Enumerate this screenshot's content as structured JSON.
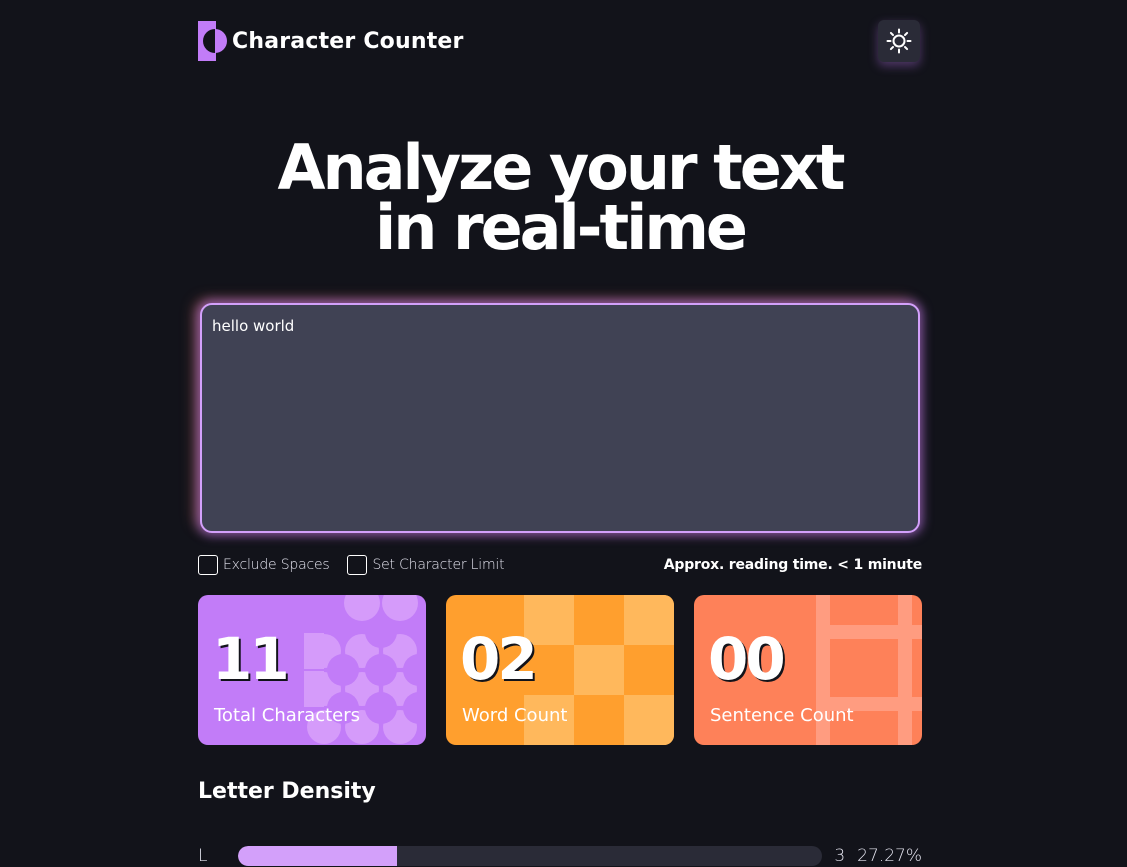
{
  "header": {
    "logo_text": "Character Counter",
    "theme_toggle_icon": "sun-icon"
  },
  "hero": {
    "line1": "Analyze your text",
    "line2": "in real-time"
  },
  "editor": {
    "value": "hello world"
  },
  "options": {
    "exclude_spaces_label": "Exclude Spaces",
    "exclude_spaces_checked": false,
    "char_limit_label": "Set Character Limit",
    "char_limit_checked": false,
    "reading_time": "Approx. reading time. < 1 minute"
  },
  "stats": {
    "total_characters": {
      "value": "11",
      "label": "Total Characters",
      "color": "#C27CF8"
    },
    "word_count": {
      "value": "02",
      "label": "Word Count",
      "color": "#FF9F2E"
    },
    "sentence_count": {
      "value": "00",
      "label": "Sentence Count",
      "color": "#FE8159"
    }
  },
  "letter_density": {
    "title": "Letter Density",
    "rows": [
      {
        "letter": "L",
        "count": "3",
        "percent": "27.27%",
        "fill_fraction": 0.2727
      }
    ]
  },
  "colors": {
    "background": "#12131A",
    "accent_purple": "#C27CF8",
    "accent_orange": "#FF9F2E",
    "accent_coral": "#FE8159"
  }
}
